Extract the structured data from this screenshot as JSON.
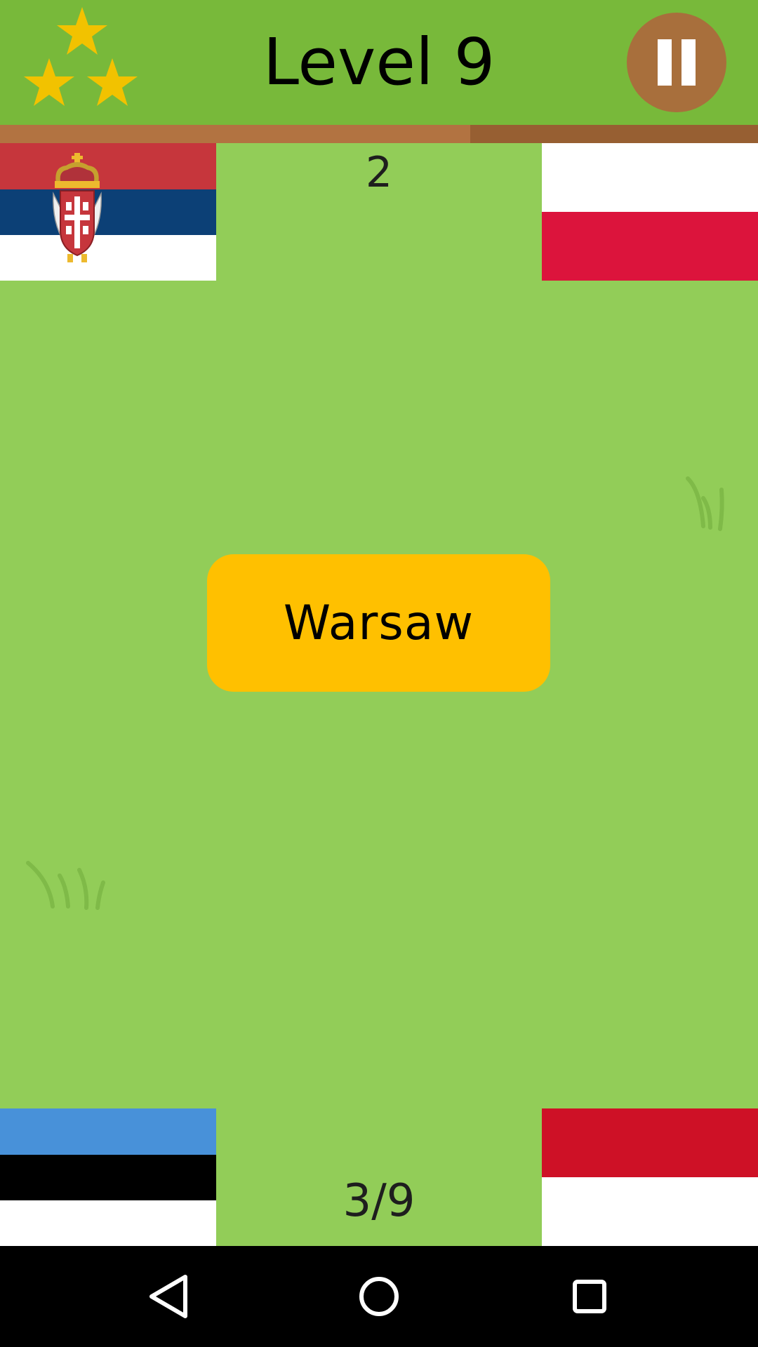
{
  "header": {
    "level_title": "Level 9",
    "stars_earned": 3,
    "stars_total": 3,
    "star_icon": "star-icon",
    "pause_icon": "pause-icon"
  },
  "timer": {
    "remaining_fraction": 0.62
  },
  "score_label": "2",
  "progress_label": "3/9",
  "answer_label": "Warsaw",
  "flags": {
    "top_left": {
      "country": "Serbia",
      "stripes": [
        "#c6363c",
        "#0c4076",
        "#ffffff"
      ],
      "emblem": "serbia-coat-of-arms"
    },
    "top_right": {
      "country": "Poland",
      "stripes": [
        "#ffffff",
        "#dc143c"
      ]
    },
    "bottom_left": {
      "country": "Estonia",
      "stripes": [
        "#4891d9",
        "#000000",
        "#ffffff"
      ]
    },
    "bottom_right": {
      "country": "Indonesia",
      "stripes": [
        "#ce1126",
        "#ffffff"
      ]
    }
  },
  "colors": {
    "header": "#78b93a",
    "field": "#92cd58",
    "answer_button": "#ffc000",
    "pause_button": "#a86f3c",
    "timer_fill": "#b27341",
    "timer_track": "#975f32",
    "star": "#f2c200"
  },
  "navbar": {
    "back_icon": "back-triangle-icon",
    "home_icon": "home-circle-icon",
    "recents_icon": "recents-square-icon"
  }
}
